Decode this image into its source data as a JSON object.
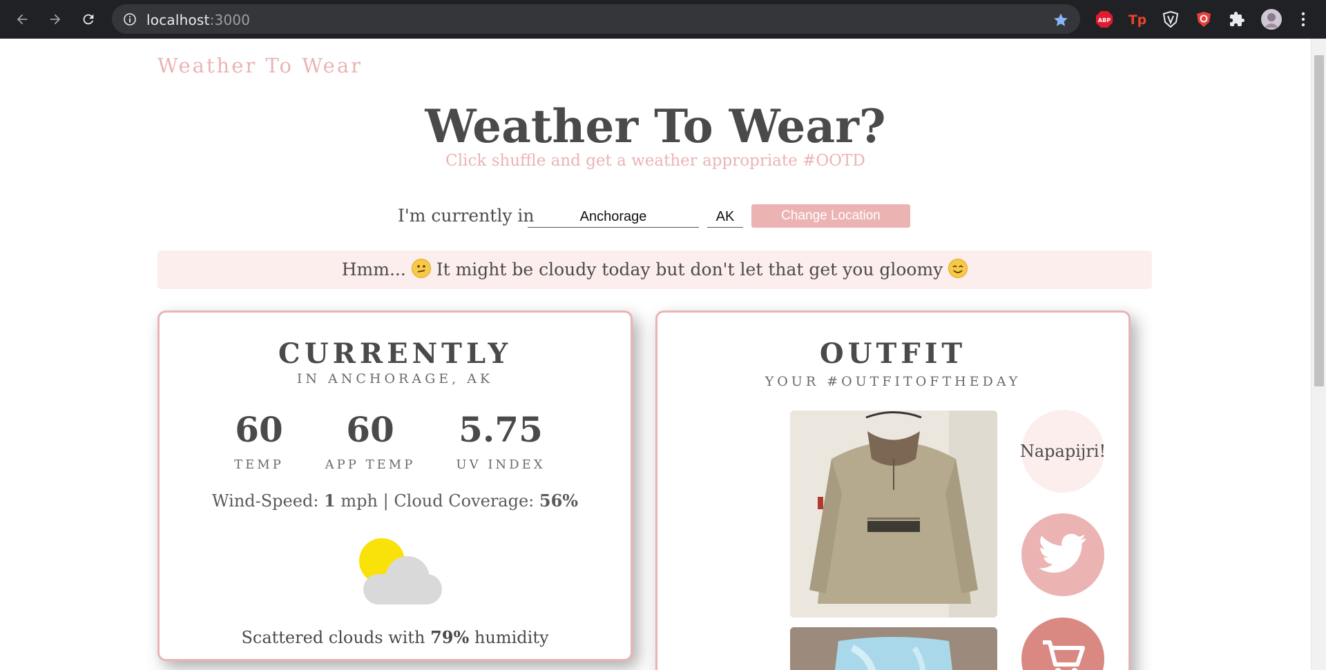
{
  "browser": {
    "url_host": "localhost",
    "url_port": ":3000"
  },
  "header": {
    "brand": "Weather To Wear",
    "title": "Weather To Wear?",
    "subtitle": "Click shuffle and get a weather appropriate #OOTD"
  },
  "location": {
    "label": "I'm currently in",
    "city": "Anchorage",
    "state": "AK",
    "button": "Change Location"
  },
  "banner": {
    "before": "Hmm...",
    "after": "It might be cloudy today but don't let that get you gloomy"
  },
  "weather": {
    "title": "CURRENTLY",
    "subtitle": "IN ANCHORAGE, AK",
    "temp": "60",
    "temp_label": "TEMP",
    "app_temp": "60",
    "app_temp_label": "APP TEMP",
    "uv": "5.75",
    "uv_label": "UV INDEX",
    "wind_prefix": "Wind-Speed:",
    "wind_value": "1",
    "wind_unit": "mph | Cloud Coverage:",
    "cloud_value": "56%",
    "desc_prefix": "Scattered clouds with",
    "humidity": "79%",
    "desc_suffix": "humidity",
    "icon": "partly-cloudy-icon"
  },
  "outfit": {
    "title": "OUTFIT",
    "subtitle": "YOUR #OUTFITOFTHEDAY",
    "brand_label": "Napapijri!",
    "icons": [
      "twitter-icon",
      "cart-icon"
    ]
  },
  "colors": {
    "accent": "#ecb3b3",
    "banner_bg": "#fdeeee",
    "text": "#4a4a4a",
    "cart": "#d98882"
  }
}
